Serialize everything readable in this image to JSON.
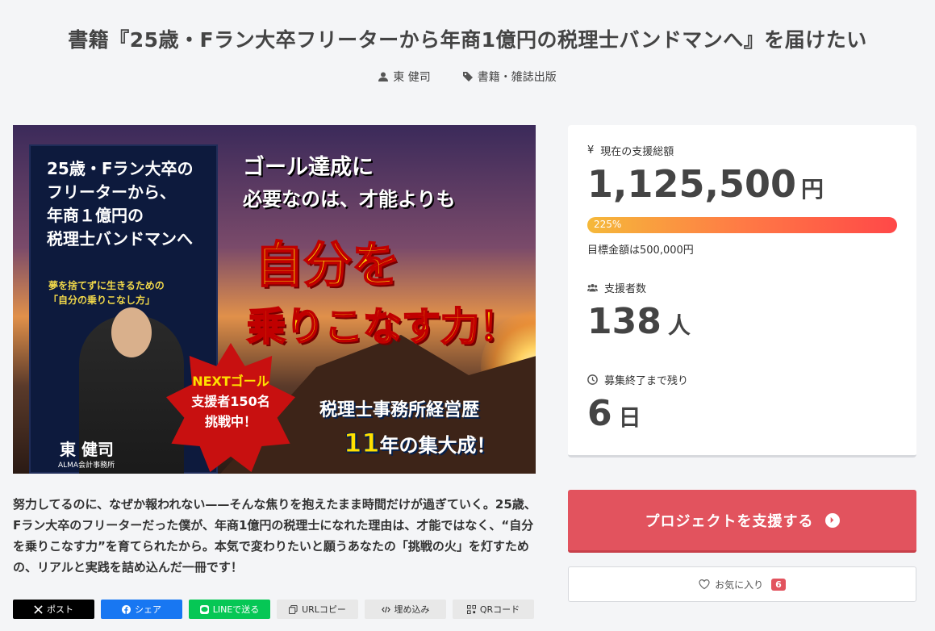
{
  "project": {
    "title": "書籍『25歳・Fラン大卒フリーターから年商1億円の税理士バンドマンへ』を届けたい",
    "author": "東 健司",
    "category": "書籍・雑誌出版"
  },
  "hero": {
    "book_title_lines": [
      "25歳・Fラン大卒の",
      "フリーターから、",
      "年商１億円の",
      "税理士バンドマンへ"
    ],
    "book_subtitle_lines": [
      "夢を捨てずに生きるための",
      "「自分の乗りこなし方」"
    ],
    "book_author": "東 健司",
    "book_office": "ALMA会計事務所",
    "headline1": "ゴール達成に",
    "headline2": "必要なのは、才能よりも",
    "big1": "自分を",
    "big2": "乗りこなす力！",
    "badge_lines": [
      "NEXTゴール",
      "支援者150名",
      "挑戦中！"
    ],
    "experience1": "税理士事務所経営歴",
    "experience_years": "11",
    "experience2": "年の集大成！"
  },
  "description": "努力してるのに、なぜか報われない——そんな焦りを抱えたまま時間だけが過ぎていく。25歳、Fラン大卒のフリーターだった僕が、年商1億円の税理士になれた理由は、才能ではなく、“自分を乗りこなす力”を育てられたから。本気で変わりたいと願うあなたの「挑戦の火」を灯すための、リアルと実践を詰め込んだ一冊です！",
  "share": {
    "x": "ポスト",
    "facebook": "シェア",
    "line": "LINEで送る",
    "url": "URLコピー",
    "embed": "埋め込み",
    "qr": "QRコード"
  },
  "stats": {
    "amount_label": "現在の支援総額",
    "amount": "1,125,500",
    "amount_unit": "円",
    "progress_percent": 225,
    "progress_label": "225%",
    "goal_text": "目標金額は500,000円",
    "supporters_label": "支援者数",
    "supporters": "138",
    "supporters_unit": "人",
    "remaining_label": "募集終了まで残り",
    "remaining": "6",
    "remaining_unit": "日"
  },
  "actions": {
    "support_button": "プロジェクトを支援する",
    "favorite_label": "お気に入り",
    "favorite_count": "6"
  },
  "colors": {
    "accent": "#e2535e",
    "progress_start": "#f5b93a",
    "progress_end": "#ff4848"
  }
}
